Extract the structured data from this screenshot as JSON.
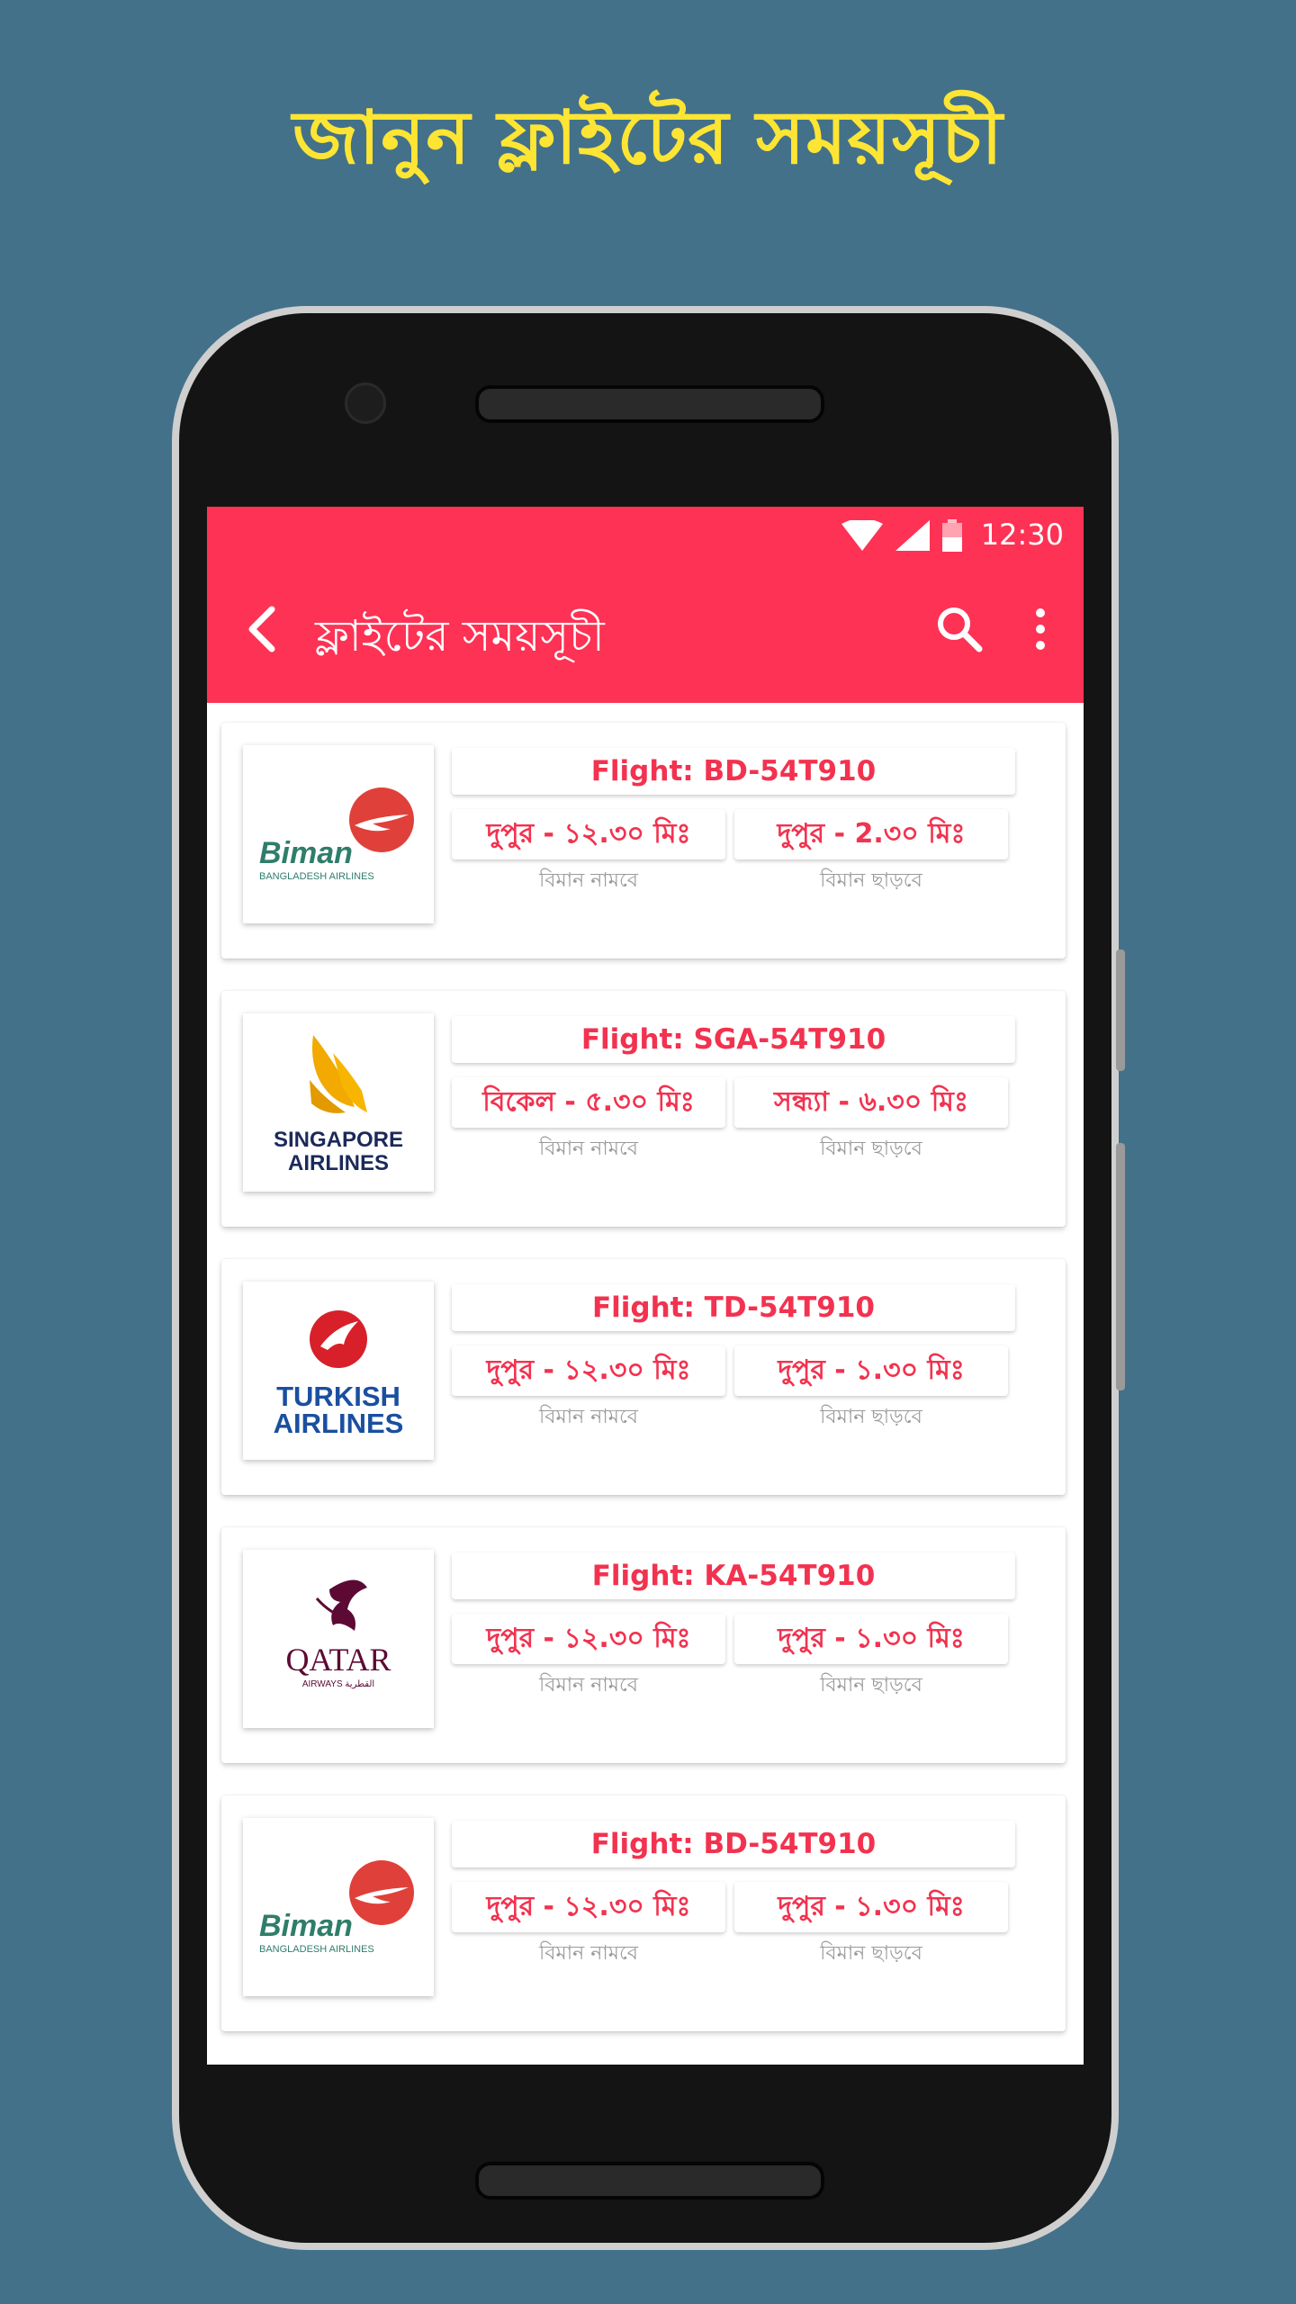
{
  "headline": "জানুন ফ্লাইটের সময়সূচী",
  "status_bar": {
    "time": "12:30"
  },
  "app_bar": {
    "title": "ফ্লাইটের সময়সূচী"
  },
  "colors": {
    "background": "#43718a",
    "accent": "#fe3254",
    "headline": "#ffe533",
    "time_text": "#f2324f"
  },
  "flights": [
    {
      "airline_logo": "biman-bangladesh-airlines",
      "logo_text": "Biman",
      "logo_subtext": "BANGLADESH AIRLINES",
      "flight": "Flight:  BD-54T910",
      "departure": "দুপুর - ১২.৩০ মিঃ",
      "arrival": "দুপুর - 2.৩০ মিঃ",
      "departure_caption": "বিমান নামবে",
      "arrival_caption": "বিমান ছাড়বে"
    },
    {
      "airline_logo": "singapore-airlines",
      "logo_text": "SINGAPORE",
      "logo_subtext": "AIRLINES",
      "flight": "Flight:  SGA-54T910",
      "departure": "বিকেল - ৫.৩০ মিঃ",
      "arrival": "সন্ধ্যা - ৬.৩০ মিঃ",
      "departure_caption": "বিমান নামবে",
      "arrival_caption": "বিমান ছাড়বে"
    },
    {
      "airline_logo": "turkish-airlines",
      "logo_text": "TURKISH",
      "logo_subtext": "AIRLINES",
      "flight": "Flight:  TD-54T910",
      "departure": "দুপুর - ১২.৩০ মিঃ",
      "arrival": "দুপুর - ১.৩০ মিঃ",
      "departure_caption": "বিমান নামবে",
      "arrival_caption": "বিমান ছাড়বে"
    },
    {
      "airline_logo": "qatar-airways",
      "logo_text": "QATAR",
      "logo_subtext": "AIRWAYS القطرية",
      "flight": "Flight:  KA-54T910",
      "departure": "দুপুর - ১২.৩০ মিঃ",
      "arrival": "দুপুর - ১.৩০ মিঃ",
      "departure_caption": "বিমান নামবে",
      "arrival_caption": "বিমান ছাড়বে"
    },
    {
      "airline_logo": "biman-bangladesh-airlines",
      "logo_text": "Biman",
      "logo_subtext": "BANGLADESH AIRLINES",
      "flight": "Flight:  BD-54T910",
      "departure": "দুপুর - ১২.৩০ মিঃ",
      "arrival": "দুপুর - ১.৩০ মিঃ",
      "departure_caption": "বিমান নামবে",
      "arrival_caption": "বিমান ছাড়বে"
    }
  ]
}
